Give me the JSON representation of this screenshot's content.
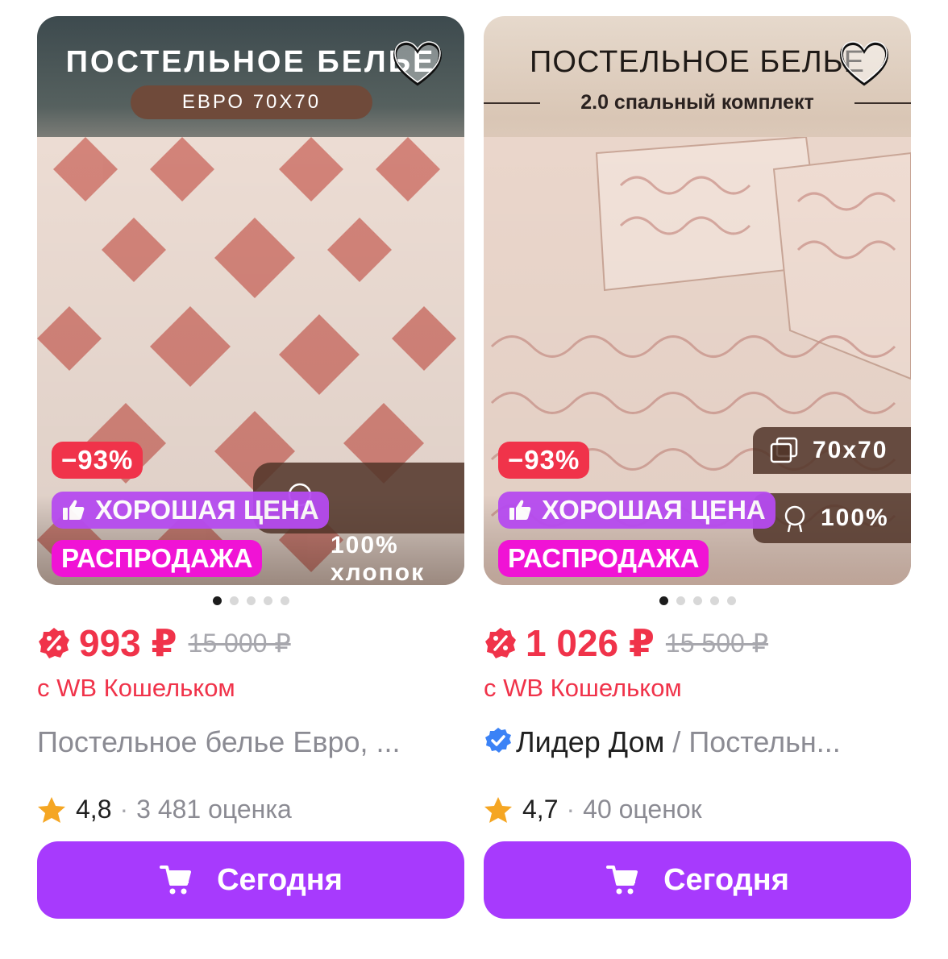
{
  "products": [
    {
      "photo_title": "ПОСТЕЛЬНОЕ БЕЛЬЕ",
      "photo_subtitle": "ЕВРО 70X70",
      "specs": [
        "100%\nхлопок"
      ],
      "discount_badge": "−93%",
      "good_price_badge": "ХОРОШАЯ ЦЕНА",
      "sale_badge": "РАСПРОДАЖА",
      "price": "993 ₽",
      "old_price": "15 000 ₽",
      "wallet_text": "с WB Кошельком",
      "brand": "",
      "title": "Постельное белье Евро, ...",
      "rating": "4,8",
      "reviews": "3 481 оценка",
      "button_label": "Сегодня"
    },
    {
      "photo_title": "ПОСТЕЛЬНОЕ БЕЛЬЕ",
      "photo_subtitle": "2.0 спальный комплект",
      "specs": [
        "70x70",
        "100%"
      ],
      "discount_badge": "−93%",
      "good_price_badge": "ХОРОШАЯ ЦЕНА",
      "sale_badge": "РАСПРОДАЖА",
      "price": "1 026 ₽",
      "old_price": "15 500 ₽",
      "wallet_text": "с WB Кошельком",
      "brand": "Лидер Дом",
      "title": " / Постельн...",
      "rating": "4,7",
      "reviews": "40 оценок",
      "button_label": "Сегодня"
    }
  ],
  "colors": {
    "price_red": "#f0334a",
    "button_purple": "#a73afd",
    "sale_pink": "#f013d5",
    "good_price_violet": "#b64bf0",
    "star_orange": "#f5a623",
    "verified_blue": "#3b82f6"
  },
  "icons": [
    "heart-icon",
    "thumbs-up-icon",
    "discount-icon",
    "verified-icon",
    "star-icon",
    "cart-icon",
    "pillow-icon",
    "cotton-icon"
  ],
  "carousel": {
    "dots": 5,
    "active": 1
  }
}
